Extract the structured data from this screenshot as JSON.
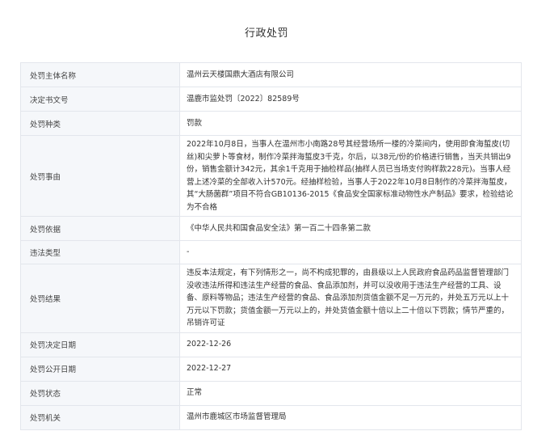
{
  "page": {
    "title": "行政处罚"
  },
  "rows": [
    {
      "label": "处罚主体名称",
      "value": "温州云天楼国鼎大酒店有限公司"
    },
    {
      "label": "决定书文号",
      "value": "温鹿市监处罚〔2022〕82589号"
    },
    {
      "label": "处罚种类",
      "value": "罚款"
    },
    {
      "label": "处罚事由",
      "value": "2022年10月8日，当事人在温州市小南路28号其经营场所一楼的冷菜间内，使用即食海蜇皮(切丝)和尖萝卜等食材，制作冷菜拌海蜇皮3千克，尔后，以38元/份的价格进行销售，当天共销出9份，销售金额计342元，其余1千克用于抽检样品(抽样人员已当场支付购样款228元)。当事人经营上述冷菜的全部收入计570元。经抽样检验，当事人于2022年10月8日制作的冷菜拌海蜇皮，其“大肠菌群”项目不符合GB10136-2015《食品安全国家标准动物性水产制品》要求，检验结论为不合格"
    },
    {
      "label": "处罚依据",
      "value": "《中华人民共和国食品安全法》第一百二十四条第二款"
    },
    {
      "label": "违法类型",
      "value": "-"
    },
    {
      "label": "处罚结果",
      "value": "违反本法规定，有下列情形之一，尚不构成犯罪的，由县级以上人民政府食品药品监督管理部门没收违法所得和违法生产经营的食品、食品添加剂，并可以没收用于违法生产经营的工具、设备、原料等物品；违法生产经营的食品、食品添加剂货值金额不足一万元的，并处五万元以上十万元以下罚款；货值金额一万元以上的，并处货值金额十倍以上二十倍以下罚款；情节严重的，吊销许可证"
    },
    {
      "label": "处罚决定日期",
      "value": "2022-12-26"
    },
    {
      "label": "处罚公开日期",
      "value": "2022-12-27"
    },
    {
      "label": "处罚状态",
      "value": "正常"
    },
    {
      "label": "处罚机关",
      "value": "温州市鹿城区市场监督管理局"
    }
  ]
}
